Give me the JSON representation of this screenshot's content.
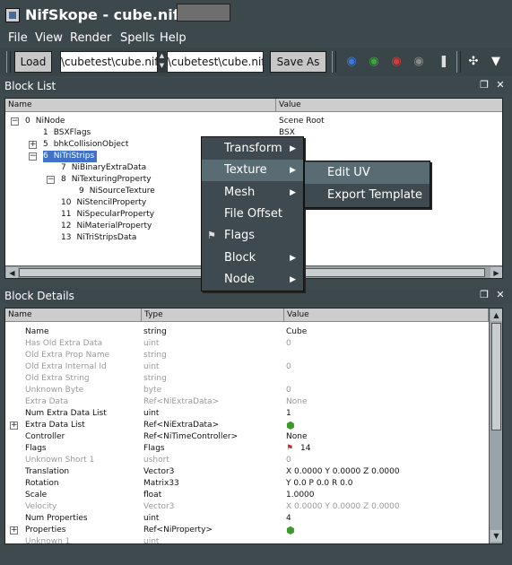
{
  "window": {
    "title": "NifSkope - cube.nif"
  },
  "menubar": [
    "File",
    "View",
    "Render",
    "Spells",
    "Help"
  ],
  "toolbar": {
    "load_label": "Load",
    "load_path": "\\cubetest\\cube.nif",
    "save_path": "\\cubetest\\cube.nif",
    "save_as_label": "Save As"
  },
  "block_list": {
    "title": "Block List",
    "headers": [
      "Name",
      "Value"
    ],
    "rows": [
      {
        "num": "0",
        "name": "NiNode",
        "value": "Scene Root",
        "indent": 0,
        "expander": "-"
      },
      {
        "num": "1",
        "name": "BSXFlags",
        "value": "BSX",
        "indent": 1,
        "expander": ""
      },
      {
        "num": "5",
        "name": "bhkCollisionObject",
        "value": "",
        "indent": 1,
        "expander": "+"
      },
      {
        "num": "6",
        "name": "NiTriStrips",
        "value": "",
        "indent": 1,
        "expander": "-",
        "selected": true
      },
      {
        "num": "7",
        "name": "NiBinaryExtraData",
        "value": "ctors)",
        "indent": 2,
        "expander": ""
      },
      {
        "num": "8",
        "name": "NiTexturingProperty",
        "value": "",
        "indent": 2,
        "expander": "-"
      },
      {
        "num": "9",
        "name": "NiSourceTexture",
        "value": ".dds",
        "indent": 3,
        "expander": ""
      },
      {
        "num": "10",
        "name": "NiStencilProperty",
        "value": "",
        "indent": 2,
        "expander": ""
      },
      {
        "num": "11",
        "name": "NiSpecularProperty",
        "value": "",
        "indent": 2,
        "expander": ""
      },
      {
        "num": "12",
        "name": "NiMaterialProperty",
        "value": "aterial",
        "indent": 2,
        "expander": ""
      },
      {
        "num": "13",
        "name": "NiTriStripsData",
        "value": "",
        "indent": 2,
        "expander": ""
      }
    ]
  },
  "block_details": {
    "title": "Block Details",
    "headers": [
      "Name",
      "Type",
      "Value"
    ],
    "rows": [
      {
        "name": "Name",
        "type": "string",
        "value": "Cube",
        "dim": false
      },
      {
        "name": "Has Old Extra Data",
        "type": "uint",
        "value": "0",
        "dim": true
      },
      {
        "name": "Old Extra Prop Name",
        "type": "string",
        "value": "",
        "dim": true
      },
      {
        "name": "Old Extra Internal Id",
        "type": "uint",
        "value": "0",
        "dim": true
      },
      {
        "name": "Old Extra String",
        "type": "string",
        "value": "",
        "dim": true
      },
      {
        "name": "Unknown Byte",
        "type": "byte",
        "value": "0",
        "dim": true
      },
      {
        "name": "Extra Data",
        "type": "Ref<NiExtraData>",
        "value": "None",
        "dim": true
      },
      {
        "name": "Num Extra Data List",
        "type": "uint",
        "value": "1",
        "dim": false
      },
      {
        "name": "Extra Data List",
        "type": "Ref<NiExtraData>",
        "value": "",
        "dim": false,
        "expander": "+",
        "icon": "green"
      },
      {
        "name": "Controller",
        "type": "Ref<NiTimeController>",
        "value": "None",
        "dim": false
      },
      {
        "name": "Flags",
        "type": "Flags",
        "value": "14",
        "dim": false,
        "icon": "flag"
      },
      {
        "name": "Unknown Short 1",
        "type": "ushort",
        "value": "0",
        "dim": true
      },
      {
        "name": "Translation",
        "type": "Vector3",
        "value": "X 0.0000 Y 0.0000 Z 0.0000",
        "dim": false
      },
      {
        "name": "Rotation",
        "type": "Matrix33",
        "value": "Y 0.0 P 0.0 R 0.0",
        "dim": false
      },
      {
        "name": "Scale",
        "type": "float",
        "value": "1.0000",
        "dim": false
      },
      {
        "name": "Velocity",
        "type": "Vector3",
        "value": "X 0.0000 Y 0.0000 Z 0.0000",
        "dim": true
      },
      {
        "name": "Num Properties",
        "type": "uint",
        "value": "4",
        "dim": false
      },
      {
        "name": "Properties",
        "type": "Ref<NiProperty>",
        "value": "",
        "dim": false,
        "expander": "+",
        "icon": "green"
      },
      {
        "name": "Unknown 1",
        "type": "uint",
        "value": "",
        "dim": true
      }
    ]
  },
  "context_menu": {
    "items": [
      {
        "label": "Transform",
        "submenu": true
      },
      {
        "label": "Texture",
        "submenu": true,
        "highlighted": true
      },
      {
        "label": "Mesh",
        "submenu": true
      },
      {
        "label": "File Offset",
        "submenu": false
      },
      {
        "label": "Flags",
        "submenu": false,
        "icon": "flag"
      },
      {
        "label": "Block",
        "submenu": true
      },
      {
        "label": "Node",
        "submenu": true
      }
    ]
  },
  "submenu": {
    "items": [
      {
        "label": "Edit UV",
        "highlighted": true
      },
      {
        "label": "Export Template",
        "highlighted": false
      }
    ]
  },
  "colors": {
    "chrome": "#3d484d",
    "selection": "#3f72c8",
    "menu_highlight": "#5a6c73"
  }
}
